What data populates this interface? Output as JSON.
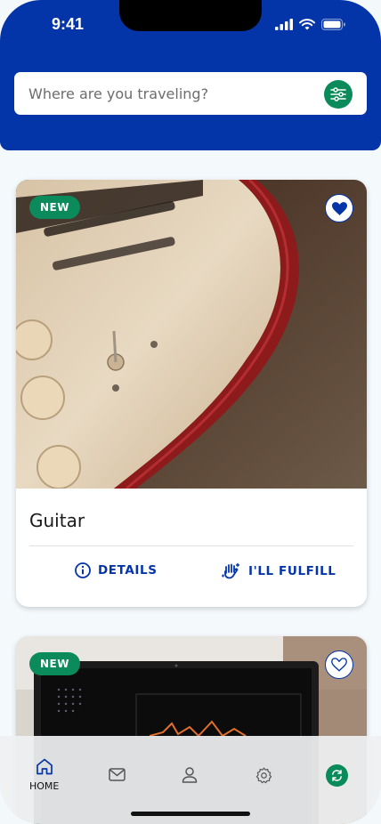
{
  "status_bar": {
    "time": "9:41"
  },
  "search": {
    "placeholder": "Where are you traveling?"
  },
  "cards": [
    {
      "badge": "NEW",
      "title": "Guitar",
      "favorited": true,
      "actions": {
        "details": "DETAILS",
        "fulfill": "I'LL FULFILL"
      }
    },
    {
      "badge": "NEW",
      "favorited": false
    }
  ],
  "nav": {
    "home_label": "HOME"
  },
  "icons": [
    "filter-icon",
    "heart-icon",
    "info-icon",
    "hand-icon",
    "home-icon",
    "mail-icon",
    "user-icon",
    "settings-icon",
    "refresh-icon"
  ],
  "colors": {
    "primary": "#0435a8",
    "accent": "#0b8a5c"
  }
}
